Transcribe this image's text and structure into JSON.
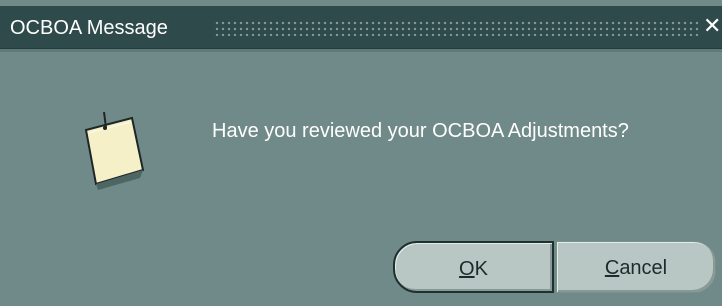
{
  "window": {
    "title": "OCBOA Message"
  },
  "dialog": {
    "message": "Have you reviewed your OCBOA Adjustments?",
    "icon": "sticky-note-icon"
  },
  "buttons": {
    "ok": {
      "mnemonic": "O",
      "rest": "K"
    },
    "cancel": {
      "mnemonic": "C",
      "rest": "ancel"
    }
  },
  "controls": {
    "close_glyph": "✕"
  },
  "colors": {
    "title_bar": "#2f4a4a",
    "dialog_background": "#6f8a88",
    "button_face": "#b8c7c3",
    "note_fill": "#f6f0c8"
  }
}
